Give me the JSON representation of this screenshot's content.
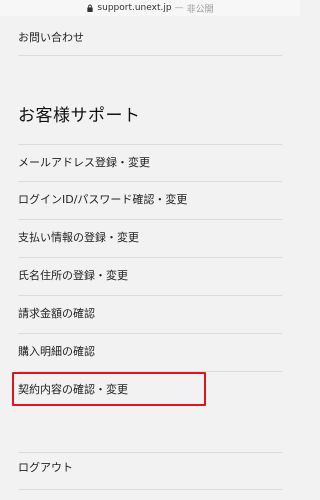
{
  "browser": {
    "url": "support.unext.jp",
    "separator": "—",
    "privacy_label": "非公開"
  },
  "top_link": "お問い合わせ",
  "support": {
    "title": "お客様サポート",
    "items": [
      {
        "label": "メールアドレス登録・変更"
      },
      {
        "label": "ログインID/パスワード確認・変更"
      },
      {
        "label": "支払い情報の登録・変更"
      },
      {
        "label": "氏名住所の登録・変更"
      },
      {
        "label": "請求金額の確認"
      },
      {
        "label": "購入明細の確認"
      },
      {
        "label": "契約内容の確認・変更",
        "highlighted": true
      }
    ]
  },
  "logout_label": "ログアウト",
  "colors": {
    "highlight": "#e2141b",
    "background": "#f2f2f2",
    "divider": "#dcdcdc"
  }
}
